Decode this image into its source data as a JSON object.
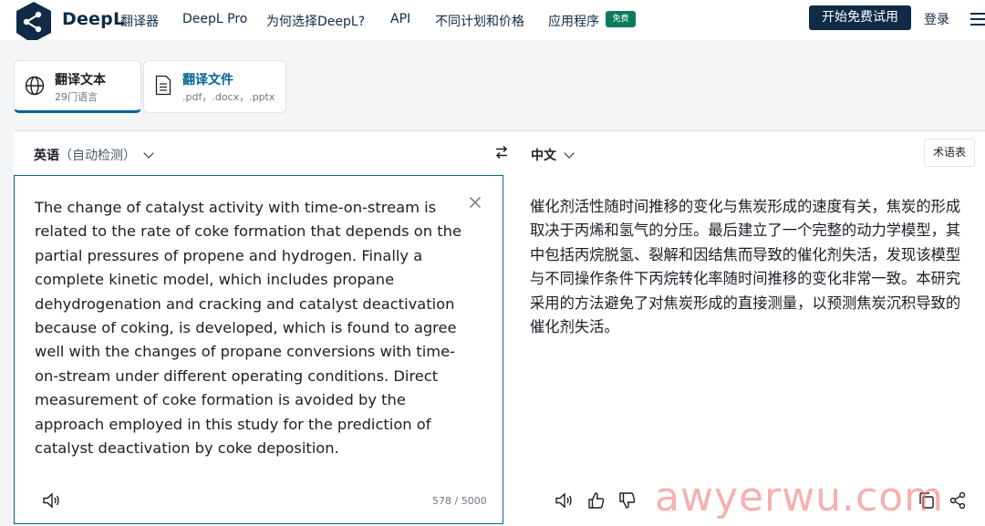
{
  "nav": {
    "brand": "DeepL",
    "brand_sub": "翻译器",
    "links": [
      "DeepL Pro",
      "为何选择DeepL?",
      "API",
      "不同计划和价格",
      "应用程序"
    ],
    "free_badge": "免费",
    "cta": "开始免费试用",
    "login": "登录"
  },
  "modes": [
    {
      "title": "翻译文本",
      "sub": "29门语言",
      "icon": "globe-icon"
    },
    {
      "title": "翻译文件",
      "sub": ".pdf，.docx，.pptx",
      "icon": "document-icon"
    }
  ],
  "translator": {
    "source_lang": "英语",
    "source_auto": "（自动检测）",
    "target_lang": "中文",
    "glossary": "术语表",
    "source_text": "The change of catalyst activity with time-on-stream is related to the rate of coke formation that depends on the partial pressures of propene and hydrogen. Finally a complete kinetic model, which includes propane dehydrogenation and cracking and catalyst deactivation because of coking, is developed, which is found to agree well with the changes of propane conversions with time-on-stream under different operating conditions. Direct measurement of coke formation is avoided by the approach employed in this study for the prediction of catalyst deactivation by coke deposition.",
    "char_count": "578 / 5000",
    "target_text": "催化剂活性随时间推移的变化与焦炭形成的速度有关，焦炭的形成取决于丙烯和氢气的分压。最后建立了一个完整的动力学模型，其中包括丙烷脱氢、裂解和因结焦而导致的催化剂失活，发现该模型与不同操作条件下丙烷转化率随时间推移的变化非常一致。本研究采用的方法避免了对焦炭形成的直接测量，以预测焦炭沉积导致的催化剂失活。"
  },
  "watermark": "awyerwu.com",
  "colors": {
    "navy": "#0f2b46",
    "accent": "#006494",
    "badge": "#0a7a5f"
  }
}
